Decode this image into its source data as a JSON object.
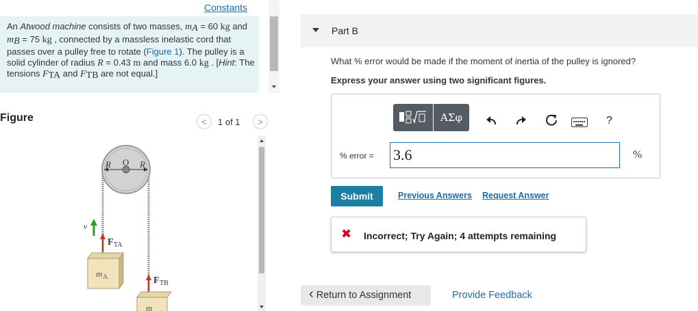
{
  "constants_link": "Constants",
  "problem": {
    "t1": "An ",
    "t2": "Atwood machine",
    "t3": " consists of two masses, ",
    "mA_sym": "m",
    "mA_sub": "A",
    "t4": " = 60",
    "kg1": "kg",
    "t5": " and ",
    "mB_sym": "m",
    "mB_sub": "B",
    "t6": " = 75 ",
    "kg2": "kg",
    "t7": " , connected by a massless inelastic cord that passes over a pulley free to rotate (",
    "fig_link": "Figure 1",
    "t8": "). The pulley is a solid cylinder of radius ",
    "R_sym": "R",
    "t9": " = 0.43 ",
    "m_unit": "m",
    "t10": " and mass 6.0 ",
    "kg3": "kg",
    "t11": " . [",
    "hint": "Hint",
    "t12": ": The tensions ",
    "FTA_sym": "F",
    "FTA_sub": "TA",
    "t13": " and ",
    "FTB_sym": "F",
    "FTB_sub": "TB",
    "t14": " are not equal.]"
  },
  "figure": {
    "title": "Figure",
    "counter": "1 of 1",
    "prev": "<",
    "next": ">",
    "labels": {
      "R_left": "R",
      "O": "O",
      "R_right": "R",
      "v": "v",
      "FTA": "F",
      "FTA_sub": "TA",
      "mA": "m",
      "mA_sub": "A",
      "FTB": "F",
      "FTB_sub": "TB",
      "mB": "m"
    }
  },
  "part": {
    "title": "Part B",
    "question": "What % error would be made if the moment of inertia of the pulley is ignored?",
    "instruction": "Express your answer using two significant figures."
  },
  "toolbar": {
    "greek_label": "ΑΣφ",
    "help_label": "?"
  },
  "answer": {
    "label": "% error =",
    "value": "3.6",
    "unit": "%"
  },
  "actions": {
    "submit": "Submit",
    "previous_answers": "Previous Answers",
    "request_answer": "Request Answer"
  },
  "feedback": {
    "icon": "✖",
    "text": "Incorrect; Try Again; 4 attempts remaining"
  },
  "footer": {
    "return": "Return to Assignment",
    "return_icon": "‹",
    "provide_feedback": "Provide Feedback"
  },
  "colors": {
    "link": "#1a6bb0",
    "submit_bg": "#1b7fa3",
    "incorrect": "#d6001c",
    "problem_bg": "#e6f3f5",
    "toolbar_bg": "#555b63"
  }
}
